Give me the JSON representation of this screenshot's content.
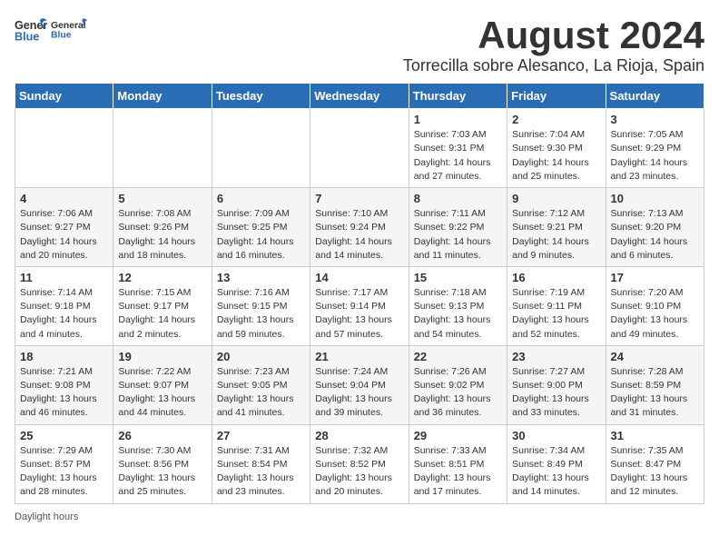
{
  "header": {
    "logo_general": "General",
    "logo_blue": "Blue",
    "month_year": "August 2024",
    "location": "Torrecilla sobre Alesanco, La Rioja, Spain"
  },
  "days_of_week": [
    "Sunday",
    "Monday",
    "Tuesday",
    "Wednesday",
    "Thursday",
    "Friday",
    "Saturday"
  ],
  "weeks": [
    [
      {
        "day": "",
        "sunrise": "",
        "sunset": "",
        "daylight": ""
      },
      {
        "day": "",
        "sunrise": "",
        "sunset": "",
        "daylight": ""
      },
      {
        "day": "",
        "sunrise": "",
        "sunset": "",
        "daylight": ""
      },
      {
        "day": "",
        "sunrise": "",
        "sunset": "",
        "daylight": ""
      },
      {
        "day": "1",
        "sunrise": "Sunrise: 7:03 AM",
        "sunset": "Sunset: 9:31 PM",
        "daylight": "Daylight: 14 hours and 27 minutes."
      },
      {
        "day": "2",
        "sunrise": "Sunrise: 7:04 AM",
        "sunset": "Sunset: 9:30 PM",
        "daylight": "Daylight: 14 hours and 25 minutes."
      },
      {
        "day": "3",
        "sunrise": "Sunrise: 7:05 AM",
        "sunset": "Sunset: 9:29 PM",
        "daylight": "Daylight: 14 hours and 23 minutes."
      }
    ],
    [
      {
        "day": "4",
        "sunrise": "Sunrise: 7:06 AM",
        "sunset": "Sunset: 9:27 PM",
        "daylight": "Daylight: 14 hours and 20 minutes."
      },
      {
        "day": "5",
        "sunrise": "Sunrise: 7:08 AM",
        "sunset": "Sunset: 9:26 PM",
        "daylight": "Daylight: 14 hours and 18 minutes."
      },
      {
        "day": "6",
        "sunrise": "Sunrise: 7:09 AM",
        "sunset": "Sunset: 9:25 PM",
        "daylight": "Daylight: 14 hours and 16 minutes."
      },
      {
        "day": "7",
        "sunrise": "Sunrise: 7:10 AM",
        "sunset": "Sunset: 9:24 PM",
        "daylight": "Daylight: 14 hours and 14 minutes."
      },
      {
        "day": "8",
        "sunrise": "Sunrise: 7:11 AM",
        "sunset": "Sunset: 9:22 PM",
        "daylight": "Daylight: 14 hours and 11 minutes."
      },
      {
        "day": "9",
        "sunrise": "Sunrise: 7:12 AM",
        "sunset": "Sunset: 9:21 PM",
        "daylight": "Daylight: 14 hours and 9 minutes."
      },
      {
        "day": "10",
        "sunrise": "Sunrise: 7:13 AM",
        "sunset": "Sunset: 9:20 PM",
        "daylight": "Daylight: 14 hours and 6 minutes."
      }
    ],
    [
      {
        "day": "11",
        "sunrise": "Sunrise: 7:14 AM",
        "sunset": "Sunset: 9:18 PM",
        "daylight": "Daylight: 14 hours and 4 minutes."
      },
      {
        "day": "12",
        "sunrise": "Sunrise: 7:15 AM",
        "sunset": "Sunset: 9:17 PM",
        "daylight": "Daylight: 14 hours and 2 minutes."
      },
      {
        "day": "13",
        "sunrise": "Sunrise: 7:16 AM",
        "sunset": "Sunset: 9:15 PM",
        "daylight": "Daylight: 13 hours and 59 minutes."
      },
      {
        "day": "14",
        "sunrise": "Sunrise: 7:17 AM",
        "sunset": "Sunset: 9:14 PM",
        "daylight": "Daylight: 13 hours and 57 minutes."
      },
      {
        "day": "15",
        "sunrise": "Sunrise: 7:18 AM",
        "sunset": "Sunset: 9:13 PM",
        "daylight": "Daylight: 13 hours and 54 minutes."
      },
      {
        "day": "16",
        "sunrise": "Sunrise: 7:19 AM",
        "sunset": "Sunset: 9:11 PM",
        "daylight": "Daylight: 13 hours and 52 minutes."
      },
      {
        "day": "17",
        "sunrise": "Sunrise: 7:20 AM",
        "sunset": "Sunset: 9:10 PM",
        "daylight": "Daylight: 13 hours and 49 minutes."
      }
    ],
    [
      {
        "day": "18",
        "sunrise": "Sunrise: 7:21 AM",
        "sunset": "Sunset: 9:08 PM",
        "daylight": "Daylight: 13 hours and 46 minutes."
      },
      {
        "day": "19",
        "sunrise": "Sunrise: 7:22 AM",
        "sunset": "Sunset: 9:07 PM",
        "daylight": "Daylight: 13 hours and 44 minutes."
      },
      {
        "day": "20",
        "sunrise": "Sunrise: 7:23 AM",
        "sunset": "Sunset: 9:05 PM",
        "daylight": "Daylight: 13 hours and 41 minutes."
      },
      {
        "day": "21",
        "sunrise": "Sunrise: 7:24 AM",
        "sunset": "Sunset: 9:04 PM",
        "daylight": "Daylight: 13 hours and 39 minutes."
      },
      {
        "day": "22",
        "sunrise": "Sunrise: 7:26 AM",
        "sunset": "Sunset: 9:02 PM",
        "daylight": "Daylight: 13 hours and 36 minutes."
      },
      {
        "day": "23",
        "sunrise": "Sunrise: 7:27 AM",
        "sunset": "Sunset: 9:00 PM",
        "daylight": "Daylight: 13 hours and 33 minutes."
      },
      {
        "day": "24",
        "sunrise": "Sunrise: 7:28 AM",
        "sunset": "Sunset: 8:59 PM",
        "daylight": "Daylight: 13 hours and 31 minutes."
      }
    ],
    [
      {
        "day": "25",
        "sunrise": "Sunrise: 7:29 AM",
        "sunset": "Sunset: 8:57 PM",
        "daylight": "Daylight: 13 hours and 28 minutes."
      },
      {
        "day": "26",
        "sunrise": "Sunrise: 7:30 AM",
        "sunset": "Sunset: 8:56 PM",
        "daylight": "Daylight: 13 hours and 25 minutes."
      },
      {
        "day": "27",
        "sunrise": "Sunrise: 7:31 AM",
        "sunset": "Sunset: 8:54 PM",
        "daylight": "Daylight: 13 hours and 23 minutes."
      },
      {
        "day": "28",
        "sunrise": "Sunrise: 7:32 AM",
        "sunset": "Sunset: 8:52 PM",
        "daylight": "Daylight: 13 hours and 20 minutes."
      },
      {
        "day": "29",
        "sunrise": "Sunrise: 7:33 AM",
        "sunset": "Sunset: 8:51 PM",
        "daylight": "Daylight: 13 hours and 17 minutes."
      },
      {
        "day": "30",
        "sunrise": "Sunrise: 7:34 AM",
        "sunset": "Sunset: 8:49 PM",
        "daylight": "Daylight: 13 hours and 14 minutes."
      },
      {
        "day": "31",
        "sunrise": "Sunrise: 7:35 AM",
        "sunset": "Sunset: 8:47 PM",
        "daylight": "Daylight: 13 hours and 12 minutes."
      }
    ]
  ],
  "footer": {
    "daylight_label": "Daylight hours"
  }
}
